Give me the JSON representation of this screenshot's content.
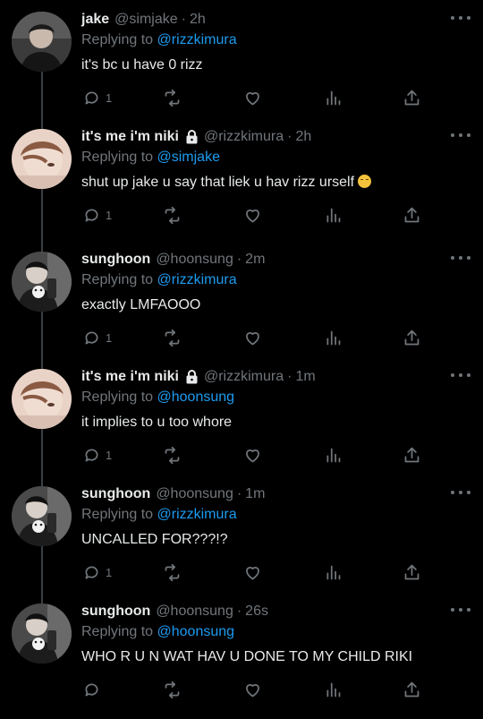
{
  "colors": {
    "background": "#000000",
    "text": "#e7e9ea",
    "muted": "#71767b",
    "mention": "#1d9bf0",
    "thread_line": "#3a3f44"
  },
  "tweets": [
    {
      "name": "jake",
      "handle": "@simjake",
      "time": "2h",
      "locked": false,
      "replying_prefix": "Replying to ",
      "replying_to": "@rizzkimura",
      "text": "it's bc u have 0 rizz",
      "reply_count": "1",
      "avatar": "avatar-jake"
    },
    {
      "name": "it's me i'm niki",
      "handle": "@rizzkimura",
      "time": "2h",
      "locked": true,
      "replying_prefix": "Replying to ",
      "replying_to": "@simjake",
      "text": "shut up jake u say that liek u hav rizz urself",
      "emoji": "unamused-face",
      "reply_count": "1",
      "avatar": "avatar-niki"
    },
    {
      "name": "sunghoon",
      "handle": "@hoonsung",
      "time": "2m",
      "locked": false,
      "replying_prefix": "Replying to ",
      "replying_to": "@rizzkimura",
      "text": "exactly LMFAOOO",
      "reply_count": "1",
      "avatar": "avatar-sunghoon"
    },
    {
      "name": "it's me i'm niki",
      "handle": "@rizzkimura",
      "time": "1m",
      "locked": true,
      "replying_prefix": "Replying to ",
      "replying_to": "@hoonsung",
      "text": "it implies to u too whore",
      "reply_count": "1",
      "avatar": "avatar-niki"
    },
    {
      "name": "sunghoon",
      "handle": "@hoonsung",
      "time": "1m",
      "locked": false,
      "replying_prefix": "Replying to ",
      "replying_to": "@rizzkimura",
      "text": "UNCALLED FOR???!?",
      "reply_count": "1",
      "avatar": "avatar-sunghoon"
    },
    {
      "name": "sunghoon",
      "handle": "@hoonsung",
      "time": "26s",
      "locked": false,
      "replying_prefix": "Replying to ",
      "replying_to": "@hoonsung",
      "text": "WHO R U N WAT HAV U DONE TO MY CHILD RIKI",
      "reply_count": "",
      "avatar": "avatar-sunghoon"
    }
  ],
  "separator": "·",
  "icons": {
    "reply": "reply-icon",
    "retweet": "retweet-icon",
    "like": "heart-icon",
    "views": "views-icon",
    "share": "share-icon",
    "more": "more-icon",
    "lock": "lock-icon"
  }
}
